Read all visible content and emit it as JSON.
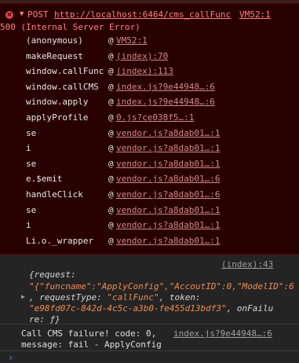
{
  "error": {
    "method": "POST",
    "url": "http://localhost:6464/cms_callFunc",
    "source": "VM52:1",
    "status": "500 (Internal Server Error)",
    "frames": [
      {
        "fn": "(anonymous)",
        "loc": "VM52:1"
      },
      {
        "fn": "makeRequest",
        "loc": "(index):70"
      },
      {
        "fn": "window.callFunc",
        "loc": "(index):113"
      },
      {
        "fn": "window.callCMS",
        "loc": "index.js?9e44948…:6"
      },
      {
        "fn": "window.apply",
        "loc": "index.js?9e44948…:6"
      },
      {
        "fn": "applyProfile",
        "loc": "0.js?ce038f5…:1"
      },
      {
        "fn": "se",
        "loc": "vendor.js?a8dab01…:1"
      },
      {
        "fn": "i",
        "loc": "vendor.js?a8dab01…:1"
      },
      {
        "fn": "se",
        "loc": "vendor.js?a8dab01…:1"
      },
      {
        "fn": "e.$emit",
        "loc": "vendor.js?a8dab01…:6"
      },
      {
        "fn": "handleClick",
        "loc": "vendor.js?a8dab01…:6"
      },
      {
        "fn": "se",
        "loc": "vendor.js?a8dab01…:1"
      },
      {
        "fn": "i",
        "loc": "vendor.js?a8dab01…:1"
      },
      {
        "fn": "Li.o._wrapper",
        "loc": "vendor.js?a8dab01…:1"
      }
    ],
    "at_symbol": "@"
  },
  "log_object": {
    "source": "(index):43",
    "line1": "{request:",
    "line2": "\"{\"funcname\":\"ApplyConfig\",\"AccoutID\":0,\"ModelID\":6",
    "line3_a": ", requestType: ",
    "line3_b": "\"callFunc\"",
    "line3_c": ", token:",
    "line4_a": "\"e98fd07c-842d-4c5c-a3b0-fe455d13bdf3\"",
    "line4_b": ", onFailu",
    "line5": "re: ƒ}"
  },
  "log_message": {
    "line1": "Call CMS failure! code: 0,",
    "line2": "message: fail - ApplyConfig",
    "source": "index.js?9e44948…:6"
  },
  "console": {
    "prompt": "›"
  },
  "colors": {
    "error_bg": "#290000",
    "error_text": "#ff8080",
    "string": "#f28b54",
    "prompt": "#4a8ef0"
  }
}
